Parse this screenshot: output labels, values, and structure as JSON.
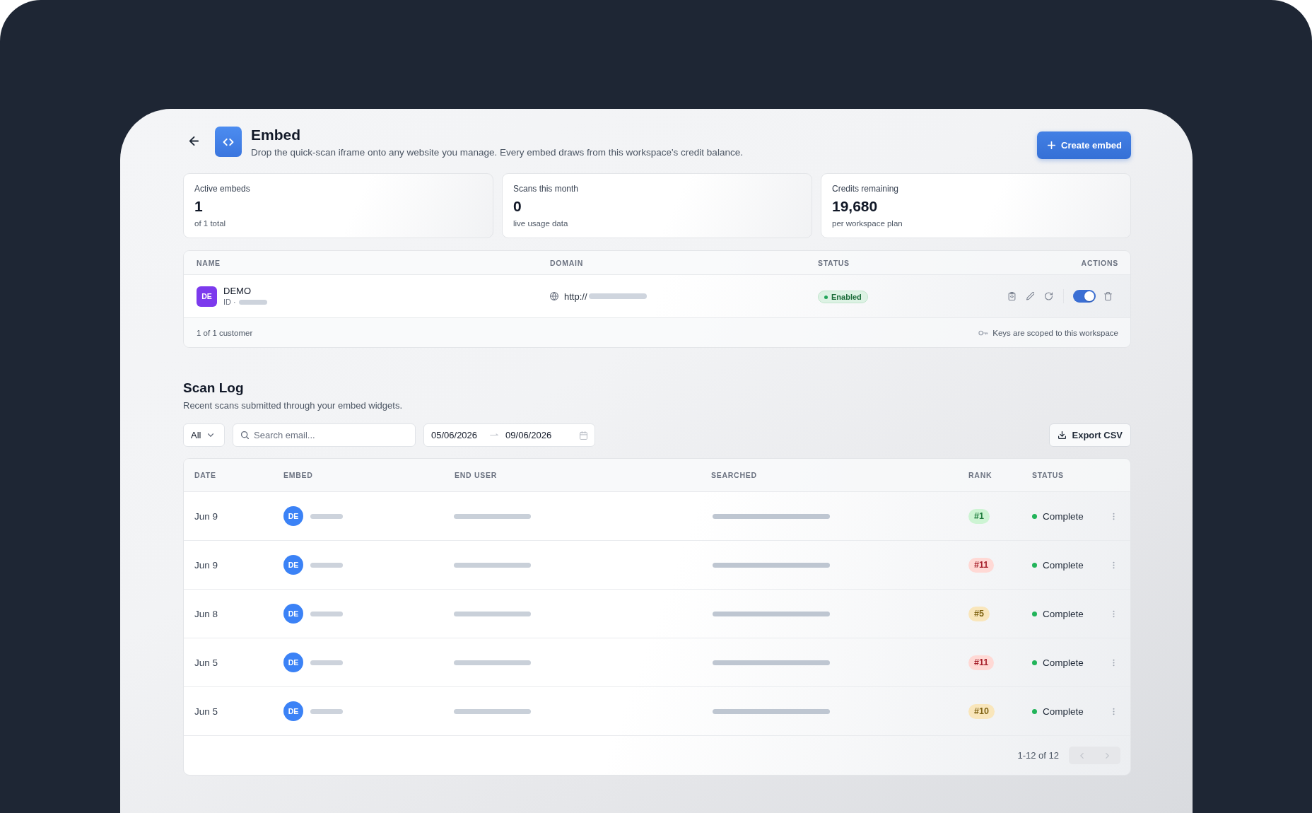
{
  "header": {
    "title": "Embed",
    "subtitle": "Drop the quick-scan iframe onto any website you manage. Every embed draws from this workspace's credit balance.",
    "create_button": "Create embed"
  },
  "stats": [
    {
      "label": "Active embeds",
      "value": "1",
      "note": "of 1 total"
    },
    {
      "label": "Scans this month",
      "value": "0",
      "note": "live usage data"
    },
    {
      "label": "Credits remaining",
      "value": "19,680",
      "note": "per workspace plan"
    }
  ],
  "embeds_table": {
    "columns": [
      "NAME",
      "DOMAIN",
      "STATUS",
      "ACTIONS"
    ],
    "rows": [
      {
        "avatar": "DE",
        "name": "DEMO",
        "id_label": "ID ·",
        "domain": "http://",
        "status": "Enabled",
        "on": true
      }
    ],
    "footer_count": "1 of 1 customer",
    "footer_note": "Keys are scoped to this workspace"
  },
  "scan_log": {
    "title": "Scan Log",
    "subtitle": "Recent scans submitted through your embed widgets.",
    "filter": {
      "value": "All"
    },
    "search": {
      "placeholder": "Search email..."
    },
    "date_range": {
      "start": "05/06/2026",
      "end": "09/06/2026"
    },
    "export_button": "Export CSV",
    "table": {
      "columns": [
        "DATE",
        "EMBED",
        "END USER",
        "SEARCHED",
        "RANK",
        "STATUS"
      ],
      "rows": [
        {
          "date": "Jun 9",
          "embed_initials": "DE",
          "rank": "#1",
          "color": "#1e7b3c",
          "status": "Complete"
        },
        {
          "date": "Jun 9",
          "embed_initials": "DE",
          "rank": "#11",
          "color": "#a61f2a",
          "status": "Complete"
        },
        {
          "date": "Jun 8",
          "embed_initials": "DE",
          "rank": "#5",
          "color": "#806414",
          "status": "Complete"
        },
        {
          "date": "Jun 5",
          "embed_initials": "DE",
          "rank": "#11",
          "color": "#a61f2a",
          "status": "Complete"
        },
        {
          "date": "Jun 5",
          "embed_initials": "DE",
          "rank": "#10",
          "color": "#806414",
          "status": "Complete"
        }
      ]
    },
    "pagination": {
      "range": "1-12 of 12",
      "buttons": [
        {
          "kind": "prev",
          "disabled": true
        },
        {
          "kind": "next",
          "disabled": true
        }
      ]
    }
  }
}
